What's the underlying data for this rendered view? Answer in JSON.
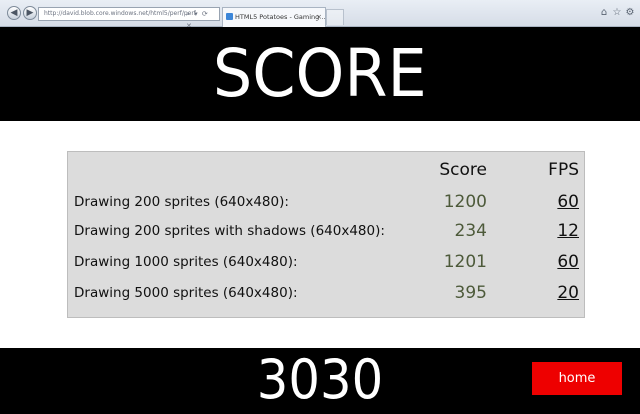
{
  "browser": {
    "address": "http://david.blob.core.windows.net/html5/perf/perf",
    "tab_title": "HTML5 Potatoes - Gaming ...",
    "tab_close": "×",
    "back_glyph": "◀",
    "forward_glyph": "▶",
    "addr_icons": "⌕ ▾ ⟳ ✕",
    "home_glyph": "⌂",
    "star_glyph": "☆",
    "gear_glyph": "⚙"
  },
  "page": {
    "title": "SCORE",
    "columns": {
      "score": "Score",
      "fps": "FPS"
    },
    "rows": [
      {
        "label": "Drawing 200 sprites (640x480):",
        "score": "1200",
        "fps": "60"
      },
      {
        "label": "Drawing 200 sprites with shadows (640x480):",
        "score": "234",
        "fps": "12"
      },
      {
        "label": "Drawing 1000 sprites (640x480):",
        "score": "1201",
        "fps": "60"
      },
      {
        "label": "Drawing 5000 sprites (640x480):",
        "score": "395",
        "fps": "20"
      }
    ],
    "total": "3030",
    "home_label": "home"
  },
  "colors": {
    "band": "#000000",
    "panel": "#dcdcdc",
    "score_text": "#4d5a3a",
    "home_button": "#ee0000"
  }
}
